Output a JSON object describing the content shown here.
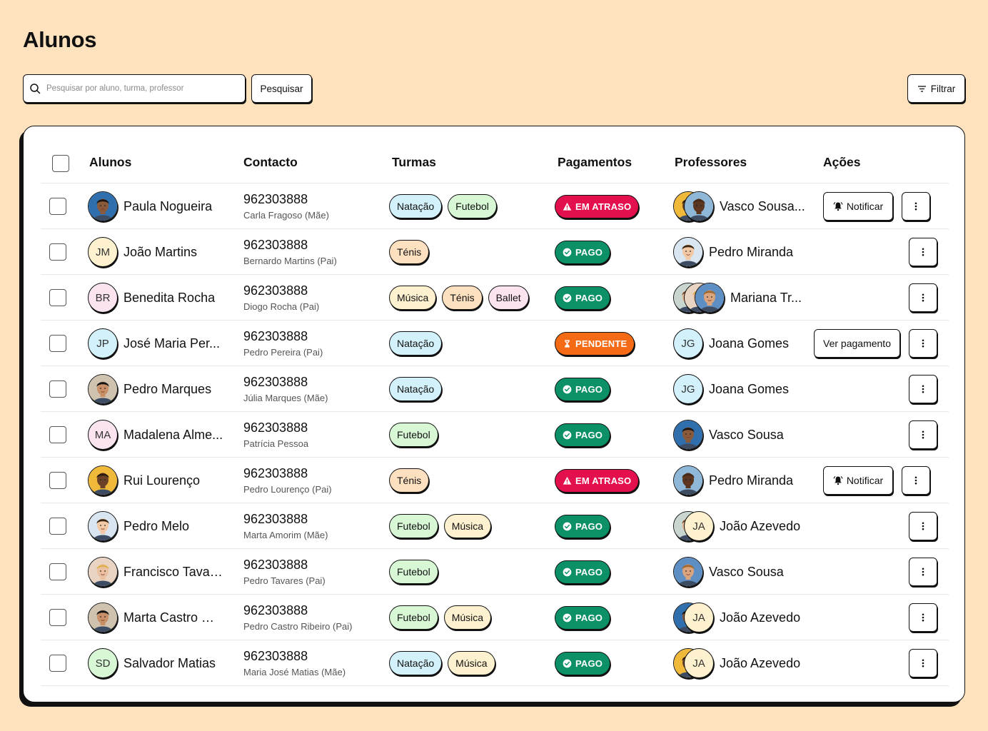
{
  "page": {
    "title": "Alunos"
  },
  "search": {
    "placeholder": "Pesquisar por aluno, turma, professor",
    "button": "Pesquisar"
  },
  "filter": {
    "label": "Filtrar"
  },
  "columns": {
    "students": "Alunos",
    "contact": "Contacto",
    "classes": "Turmas",
    "payments": "Pagamentos",
    "teachers": "Professores",
    "actions": "Ações"
  },
  "actions": {
    "notify": "Notificar",
    "view_payment": "Ver pagamento"
  },
  "status_labels": {
    "overdue": "EM ATRASO",
    "paid": "PAGO",
    "pending": "PENDENTE"
  },
  "colors": {
    "overdue": "#e4104e",
    "paid": "#0c9068",
    "pending": "#f56a15",
    "page_bg": "#fde2bd"
  },
  "tag_colors": {
    "Natação": "#d3f1fb",
    "Futebol": "#d8f7d5",
    "Ténis": "#fde0c0",
    "Música": "#fdf1cf",
    "Ballet": "#fbe4f0"
  },
  "students": [
    {
      "name": "Paula Nogueira",
      "avatar": "photo",
      "phone": "962303888",
      "parent": "Carla Fragoso (Mãe)",
      "classes": [
        "Natação",
        "Futebol"
      ],
      "status": "overdue",
      "teachers": [
        "photo",
        "photo"
      ],
      "teacher_name": "Vasco Sousa...",
      "action": "notify"
    },
    {
      "name": "João Martins",
      "avatar": "JM",
      "avatar_bg": "#fdf1cf",
      "phone": "962303888",
      "parent": "Bernardo Martins (Pai)",
      "classes": [
        "Ténis"
      ],
      "status": "paid",
      "teachers": [
        "photo"
      ],
      "teacher_name": "Pedro Miranda",
      "action": "none"
    },
    {
      "name": "Benedita Rocha",
      "avatar": "BR",
      "avatar_bg": "#fbe4f0",
      "phone": "962303888",
      "parent": "Diogo Rocha (Pai)",
      "classes": [
        "Música",
        "Ténis",
        "Ballet"
      ],
      "status": "paid",
      "teachers": [
        "photo",
        "photo",
        "photo"
      ],
      "teacher_name": "Mariana Tr...",
      "action": "none"
    },
    {
      "name": "José Maria Per...",
      "avatar": "JP",
      "avatar_bg": "#d3f1fb",
      "phone": "962303888",
      "parent": "Pedro Pereira (Pai)",
      "classes": [
        "Natação"
      ],
      "status": "pending",
      "teachers": [
        "JG"
      ],
      "teacher_name": "Joana Gomes",
      "action": "view_payment"
    },
    {
      "name": "Pedro Marques",
      "avatar": "photo",
      "phone": "962303888",
      "parent": "Júlia Marques (Mãe)",
      "classes": [
        "Natação"
      ],
      "status": "paid",
      "teachers": [
        "JG"
      ],
      "teacher_name": "Joana Gomes",
      "action": "none"
    },
    {
      "name": "Madalena Alme...",
      "avatar": "MA",
      "avatar_bg": "#fbe4f0",
      "phone": "962303888",
      "parent": "Patrícia Pessoa",
      "classes": [
        "Futebol"
      ],
      "status": "paid",
      "teachers": [
        "photo"
      ],
      "teacher_name": "Vasco Sousa",
      "action": "none"
    },
    {
      "name": "Rui Lourenço",
      "avatar": "photo",
      "phone": "962303888",
      "parent": "Pedro Lourenço (Pai)",
      "classes": [
        "Ténis"
      ],
      "status": "overdue",
      "teachers": [
        "photo"
      ],
      "teacher_name": "Pedro Miranda",
      "action": "notify"
    },
    {
      "name": "Pedro Melo",
      "avatar": "photo",
      "phone": "962303888",
      "parent": "Marta Amorim (Mãe)",
      "classes": [
        "Futebol",
        "Música"
      ],
      "status": "paid",
      "teachers": [
        "photo",
        "JA"
      ],
      "teacher_name": "João Azevedo",
      "action": "none"
    },
    {
      "name": "Francisco Tavar...",
      "avatar": "photo",
      "phone": "962303888",
      "parent": "Pedro Tavares (Pai)",
      "classes": [
        "Futebol"
      ],
      "status": "paid",
      "teachers": [
        "photo"
      ],
      "teacher_name": "Vasco Sousa",
      "action": "none"
    },
    {
      "name": "Marta Castro Ri...",
      "avatar": "photo",
      "phone": "962303888",
      "parent": "Pedro Castro Ribeiro (Pai)",
      "classes": [
        "Futebol",
        "Música"
      ],
      "status": "paid",
      "teachers": [
        "photo",
        "JA"
      ],
      "teacher_name": "João Azevedo",
      "action": "none"
    },
    {
      "name": "Salvador Matias",
      "avatar": "SD",
      "avatar_bg": "#d8f7d5",
      "phone": "962303888",
      "parent": "Maria José Matias (Mãe)",
      "classes": [
        "Natação",
        "Música"
      ],
      "status": "paid",
      "teachers": [
        "photo",
        "JA"
      ],
      "teacher_name": "João Azevedo",
      "action": "none"
    }
  ]
}
